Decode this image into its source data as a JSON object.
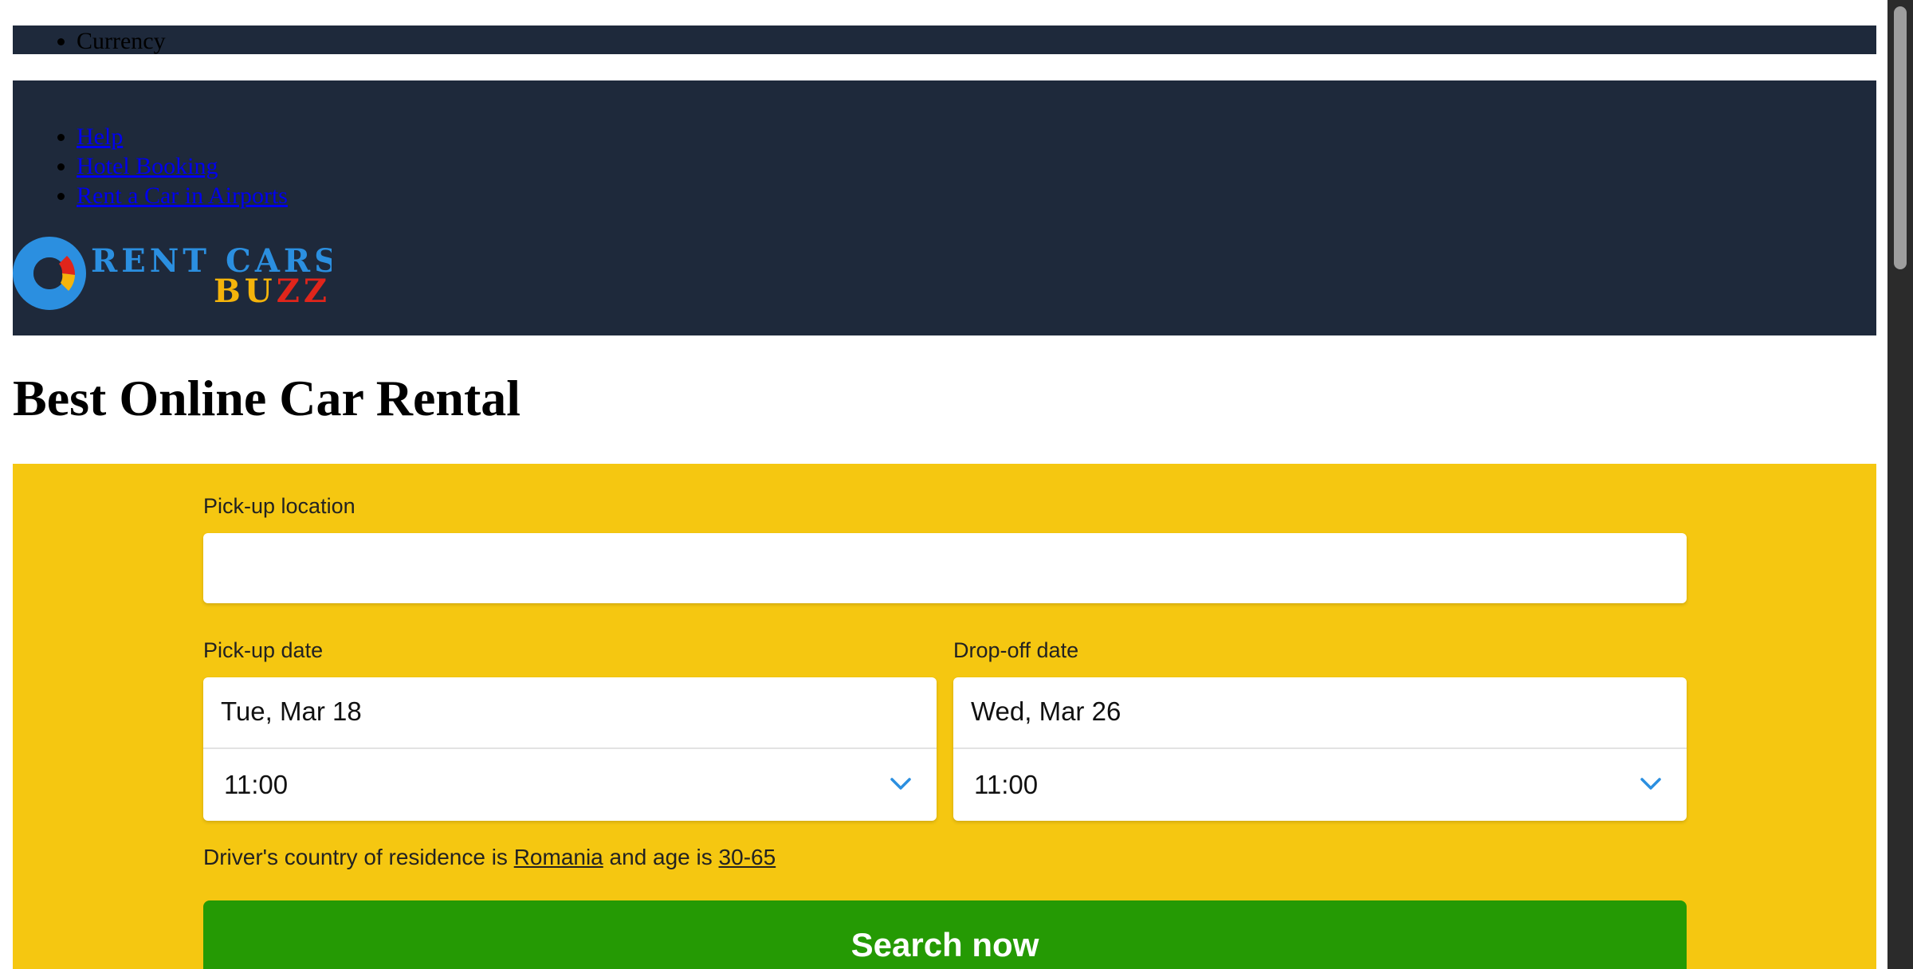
{
  "currency_bar": {
    "item": "Currency"
  },
  "nav": {
    "links": [
      "Help",
      "Hotel Booking",
      "Rent a Car in Airports"
    ]
  },
  "logo": {
    "line1": "RENT CARS",
    "line2_a": "BU",
    "line2_b": "ZZ",
    "colors": {
      "blue": "#2b8fe0",
      "red": "#e0251b",
      "yellow": "#f5b40b",
      "dark": "#1e293b"
    }
  },
  "page_title": "Best Online Car Rental",
  "search": {
    "pickup_location_label": "Pick-up location",
    "pickup_location_value": "",
    "pickup_date_label": "Pick-up date",
    "pickup_date": "Tue, Mar 18",
    "pickup_time": "11:00",
    "dropoff_date_label": "Drop-off date",
    "dropoff_date": "Wed, Mar 26",
    "dropoff_time": "11:00",
    "residence_prefix": "Driver's country of residence is ",
    "residence_country": "Romania",
    "residence_middle": " and age is ",
    "residence_age": "30-65",
    "submit_label": "Search now"
  },
  "colors": {
    "header_bg": "#1e293b",
    "panel_bg": "#f5c711",
    "button_bg": "#259a04",
    "chevron": "#2b8fe0"
  }
}
